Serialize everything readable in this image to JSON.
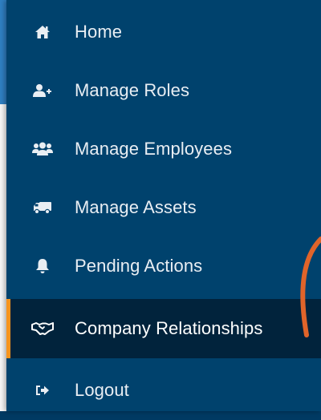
{
  "sidebar": {
    "items": [
      {
        "label": "Home",
        "icon": "home-icon"
      },
      {
        "label": "Manage Roles",
        "icon": "user-plus-icon"
      },
      {
        "label": "Manage Employees",
        "icon": "users-icon"
      },
      {
        "label": "Manage Assets",
        "icon": "truck-icon"
      },
      {
        "label": "Pending Actions",
        "icon": "bell-icon"
      },
      {
        "label": "Company Relationships",
        "icon": "handshake-icon",
        "active": true
      },
      {
        "label": "Logout",
        "icon": "sign-out-icon"
      }
    ]
  },
  "colors": {
    "sidebar_bg": "#00426d",
    "active_bg": "#01233c",
    "active_indicator": "#f7941d",
    "header_band": "#2f7fc2",
    "annotation_arc": "#e0642a"
  }
}
